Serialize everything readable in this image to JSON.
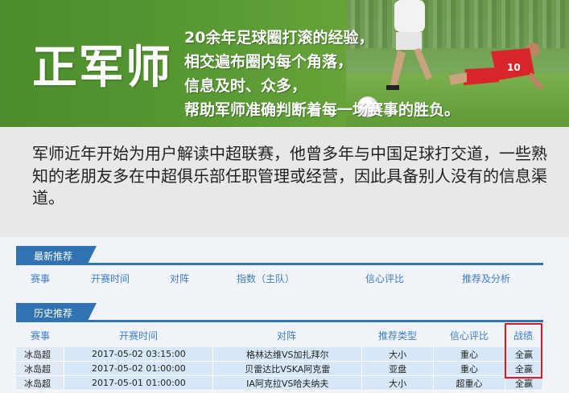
{
  "banner": {
    "brand": "正军师",
    "slogan": [
      "20余年足球圈打滚的经验，",
      "相交遍布圈内每个角落，",
      "信息及时、众多，",
      "帮助军师准确判断着每一场赛事的胜负。"
    ]
  },
  "intro": {
    "text": "军师近年开始为用户解读中超联赛，他曾多年与中国足球打交道，一些熟知的老朋友多在中超俱乐部任职管理或经营，因此具备别人没有的信息渠道。"
  },
  "latest": {
    "title": "最新推荐",
    "columns": [
      "赛事",
      "开赛时间",
      "对阵",
      "指数（主队）",
      "信心评比",
      "推荐及分析"
    ]
  },
  "history": {
    "title": "历史推荐",
    "columns": [
      "赛事",
      "开赛时间",
      "对阵",
      "推荐类型",
      "信心评比",
      "战绩"
    ],
    "rows": [
      [
        "冰岛超",
        "2017-05-02 03:15:00",
        "格林达维VS加扎拜尔",
        "大小",
        "重心",
        "全赢"
      ],
      [
        "冰岛超",
        "2017-05-02 01:00:00",
        "贝雷达比VSKA阿克雷",
        "亚盘",
        "重心",
        "全赢"
      ],
      [
        "冰岛超",
        "2017-05-01 01:00:00",
        "IA阿克拉VS哈夫纳夫",
        "大小",
        "超重心",
        "全赢"
      ]
    ]
  },
  "colors": {
    "banner_green": "#5a9a33",
    "tab_blue": "#2f73b3",
    "header_text_blue": "#3f7ec1",
    "row_blue": "#d7e7f7",
    "highlight_red": "#e0161e"
  }
}
